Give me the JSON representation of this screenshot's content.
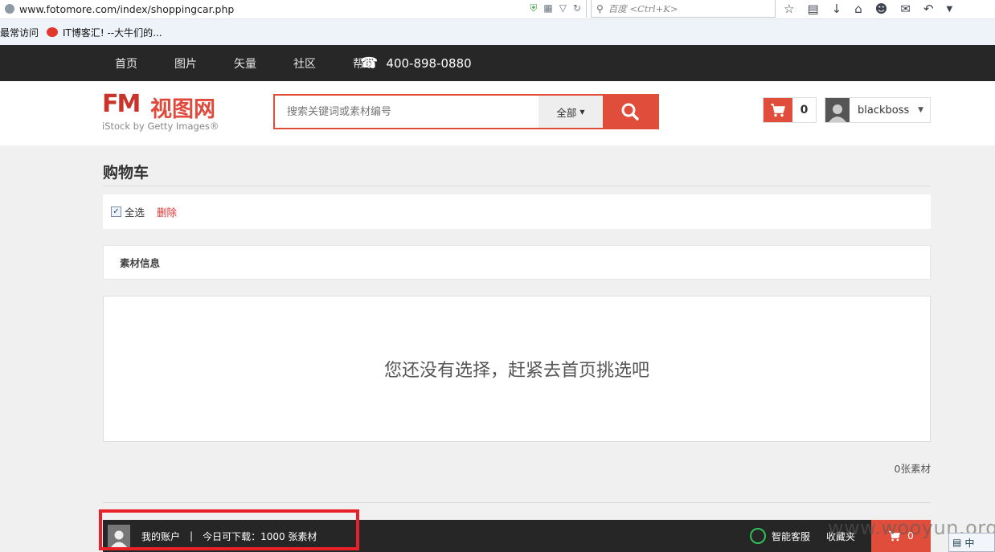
{
  "browser": {
    "url": "www.fotomore.com/index/shoppingcar.php",
    "search_placeholder": "百度 <Ctrl+K>",
    "bookmarks": [
      {
        "label": "最常访问"
      },
      {
        "label": "IT博客汇! --大牛们的..."
      }
    ]
  },
  "topnav": {
    "items": [
      "首页",
      "图片",
      "矢量",
      "社区",
      "帮助"
    ],
    "phone": "400-898-0880"
  },
  "header": {
    "logo_mark": "FM",
    "logo_cn": "视图网",
    "logo_sub": "iStock by Getty Images®",
    "search_placeholder": "搜索关键词或素材编号",
    "scope_label": "全部",
    "cart_count": "0",
    "username": "blackboss"
  },
  "cart_page": {
    "title": "购物车",
    "select_all_label": "全选",
    "delete_label": "删除",
    "info_header": "素材信息",
    "empty_message": "您还没有选择，赶紧去首页挑选吧",
    "total_label": "0张素材"
  },
  "bottombar": {
    "account_label": "我的账户",
    "separator": "|",
    "quota_label": "今日可下载：1000 张素材",
    "service_label": "智能客服",
    "favorites_label": "收藏夹",
    "cart_count": "0"
  },
  "overlay": {
    "watermark": "www.wooyun.org",
    "ime_label": "中"
  },
  "colors": {
    "accent": "#e14d3b",
    "nav_bg": "#272727",
    "highlight": "#e8202a"
  }
}
